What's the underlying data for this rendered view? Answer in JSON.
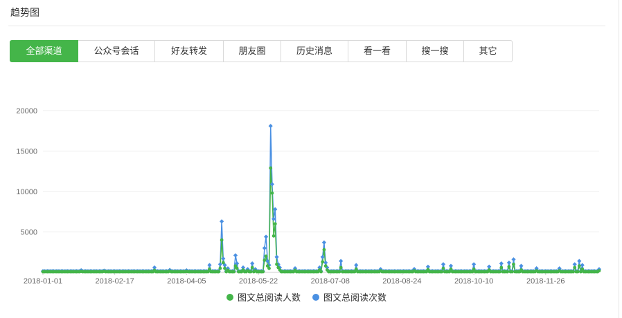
{
  "panel": {
    "title": "趋势图"
  },
  "tabs": [
    "全部渠道",
    "公众号会话",
    "好友转发",
    "朋友圈",
    "历史消息",
    "看一看",
    "搜一搜",
    "其它"
  ],
  "active_tab": 0,
  "colors": {
    "accent": "#44b549",
    "series_people": "#44b549",
    "series_reads": "#4a90e2"
  },
  "chart_data": {
    "type": "line",
    "title": "",
    "xlabel": "",
    "ylabel": "",
    "ylim": [
      0,
      20000
    ],
    "yticks": [
      0,
      5000,
      10000,
      15000,
      20000
    ],
    "ytick_labels": [
      "",
      "5000",
      "10000",
      "15000",
      "20000"
    ],
    "x_start": "2018-01-01",
    "x_end": "2018-12-31",
    "xtick_labels": [
      "2018-01-01",
      "2018-02-17",
      "2018-04-05",
      "2018-05-22",
      "2018-07-08",
      "2018-08-24",
      "2018-10-10",
      "2018-11-26"
    ],
    "grid": true,
    "legend_position": "bottom",
    "baseline_people": 80,
    "baseline_reads": 150,
    "series": [
      {
        "name": "图文总阅读人数",
        "points": [
          [
            "2018-01-01",
            80
          ],
          [
            "2018-01-26",
            120
          ],
          [
            "2018-02-10",
            130
          ],
          [
            "2018-03-15",
            250
          ],
          [
            "2018-03-25",
            150
          ],
          [
            "2018-04-05",
            120
          ],
          [
            "2018-04-20",
            400
          ],
          [
            "2018-04-27",
            500
          ],
          [
            "2018-04-28",
            4000
          ],
          [
            "2018-04-29",
            1200
          ],
          [
            "2018-04-30",
            500
          ],
          [
            "2018-05-02",
            250
          ],
          [
            "2018-05-07",
            800
          ],
          [
            "2018-05-08",
            500
          ],
          [
            "2018-05-12",
            300
          ],
          [
            "2018-05-15",
            200
          ],
          [
            "2018-05-18",
            600
          ],
          [
            "2018-05-20",
            200
          ],
          [
            "2018-05-26",
            1500
          ],
          [
            "2018-05-27",
            2000
          ],
          [
            "2018-05-28",
            800
          ],
          [
            "2018-05-29",
            500
          ],
          [
            "2018-05-30",
            12900
          ],
          [
            "2018-05-31",
            9800
          ],
          [
            "2018-06-01",
            4500
          ],
          [
            "2018-06-02",
            6000
          ],
          [
            "2018-06-03",
            1000
          ],
          [
            "2018-06-04",
            600
          ],
          [
            "2018-06-05",
            300
          ],
          [
            "2018-06-15",
            250
          ],
          [
            "2018-07-01",
            300
          ],
          [
            "2018-07-03",
            1300
          ],
          [
            "2018-07-04",
            2800
          ],
          [
            "2018-07-05",
            800
          ],
          [
            "2018-07-06",
            300
          ],
          [
            "2018-07-15",
            600
          ],
          [
            "2018-07-25",
            400
          ],
          [
            "2018-08-10",
            200
          ],
          [
            "2018-09-01",
            200
          ],
          [
            "2018-09-10",
            350
          ],
          [
            "2018-09-20",
            500
          ],
          [
            "2018-09-25",
            400
          ],
          [
            "2018-10-10",
            400
          ],
          [
            "2018-10-20",
            300
          ],
          [
            "2018-10-28",
            600
          ],
          [
            "2018-11-02",
            700
          ],
          [
            "2018-11-05",
            1000
          ],
          [
            "2018-11-10",
            300
          ],
          [
            "2018-11-20",
            200
          ],
          [
            "2018-12-05",
            200
          ],
          [
            "2018-12-15",
            600
          ],
          [
            "2018-12-18",
            800
          ],
          [
            "2018-12-20",
            400
          ],
          [
            "2018-12-31",
            200
          ]
        ]
      },
      {
        "name": "图文总阅读次数",
        "points": [
          [
            "2018-01-01",
            150
          ],
          [
            "2018-01-26",
            250
          ],
          [
            "2018-02-10",
            220
          ],
          [
            "2018-03-15",
            600
          ],
          [
            "2018-03-25",
            300
          ],
          [
            "2018-04-05",
            250
          ],
          [
            "2018-04-20",
            900
          ],
          [
            "2018-04-27",
            1000
          ],
          [
            "2018-04-28",
            6300
          ],
          [
            "2018-04-29",
            1700
          ],
          [
            "2018-04-30",
            900
          ],
          [
            "2018-05-02",
            500
          ],
          [
            "2018-05-07",
            2100
          ],
          [
            "2018-05-08",
            1100
          ],
          [
            "2018-05-12",
            600
          ],
          [
            "2018-05-15",
            400
          ],
          [
            "2018-05-18",
            1100
          ],
          [
            "2018-05-20",
            400
          ],
          [
            "2018-05-26",
            3000
          ],
          [
            "2018-05-27",
            4400
          ],
          [
            "2018-05-28",
            1400
          ],
          [
            "2018-05-29",
            900
          ],
          [
            "2018-05-30",
            18100
          ],
          [
            "2018-05-31",
            10900
          ],
          [
            "2018-06-01",
            6600
          ],
          [
            "2018-06-02",
            7800
          ],
          [
            "2018-06-03",
            1900
          ],
          [
            "2018-06-04",
            1000
          ],
          [
            "2018-06-05",
            600
          ],
          [
            "2018-06-15",
            500
          ],
          [
            "2018-07-01",
            600
          ],
          [
            "2018-07-03",
            1900
          ],
          [
            "2018-07-04",
            3700
          ],
          [
            "2018-07-05",
            1200
          ],
          [
            "2018-07-06",
            600
          ],
          [
            "2018-07-15",
            1400
          ],
          [
            "2018-07-25",
            900
          ],
          [
            "2018-08-10",
            400
          ],
          [
            "2018-09-01",
            400
          ],
          [
            "2018-09-10",
            700
          ],
          [
            "2018-09-20",
            1000
          ],
          [
            "2018-09-25",
            800
          ],
          [
            "2018-10-10",
            1000
          ],
          [
            "2018-10-20",
            700
          ],
          [
            "2018-10-28",
            1100
          ],
          [
            "2018-11-02",
            1200
          ],
          [
            "2018-11-05",
            1600
          ],
          [
            "2018-11-10",
            800
          ],
          [
            "2018-11-20",
            500
          ],
          [
            "2018-12-05",
            500
          ],
          [
            "2018-12-15",
            1000
          ],
          [
            "2018-12-18",
            1400
          ],
          [
            "2018-12-20",
            900
          ],
          [
            "2018-12-31",
            400
          ]
        ]
      }
    ]
  }
}
